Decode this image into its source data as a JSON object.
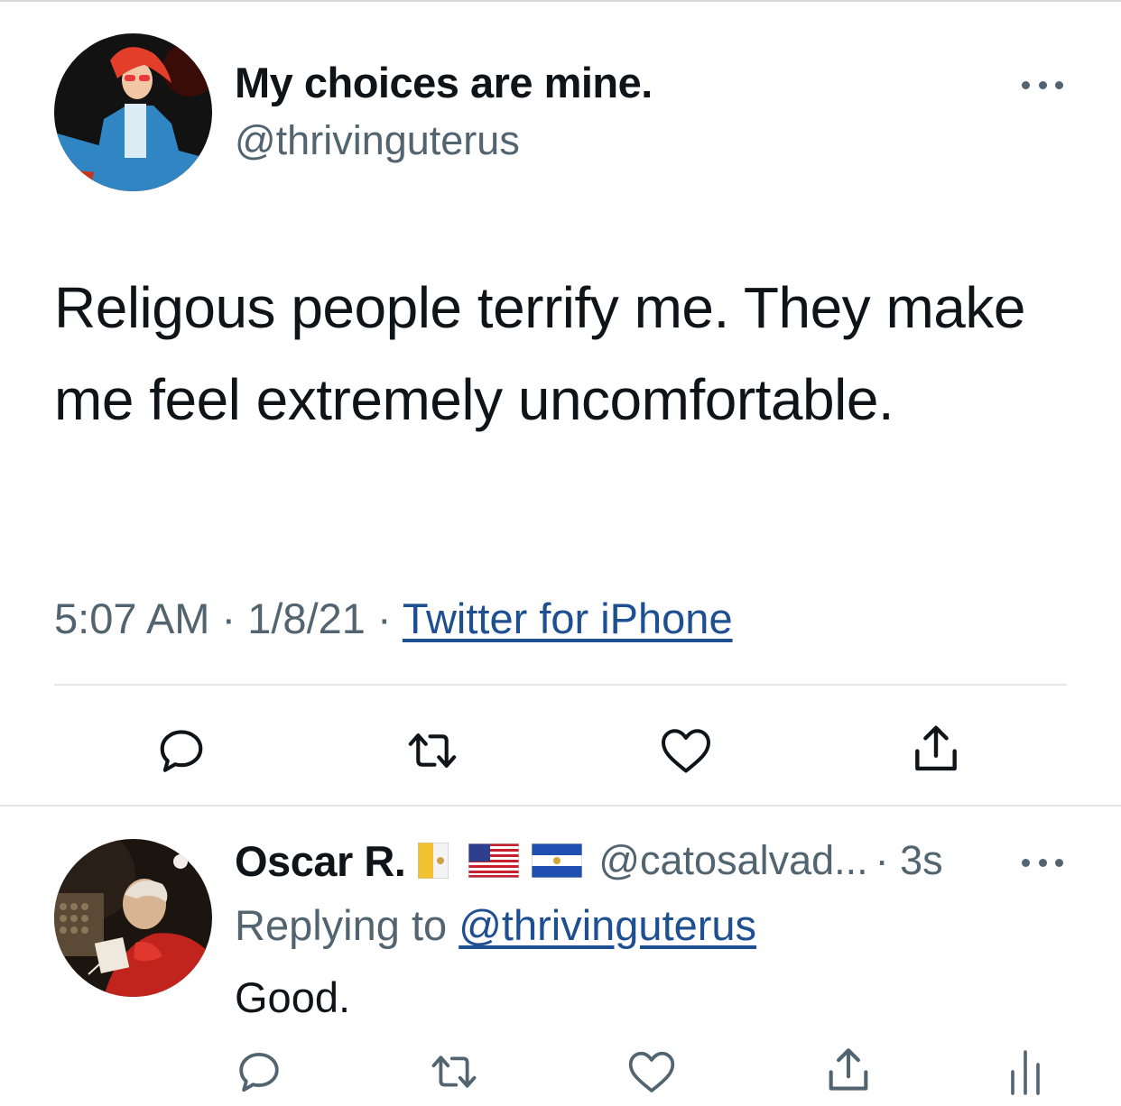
{
  "tweet": {
    "display_name": "My choices are mine.",
    "handle": "@thrivinguterus",
    "text": "Religous people terrify me. They make me feel extremely uncomfortable.",
    "time": "5:07 AM",
    "date": "1/8/21",
    "separator": "·",
    "source": "Twitter for iPhone",
    "avatar_icon": "illustrated-woman-avatar",
    "more_icon": "more-horizontal-icon",
    "actions": [
      "reply-icon",
      "retweet-icon",
      "like-icon",
      "share-icon"
    ]
  },
  "reply": {
    "display_name": "Oscar R.",
    "flags": [
      "vatican-flag",
      "us-flag",
      "el-salvador-flag"
    ],
    "handle": "@catosalvad...",
    "time": "· 3s",
    "replying_prefix": "Replying to",
    "replying_mention": "@thrivinguterus",
    "text": "Good.",
    "avatar_icon": "painting-portrait-avatar",
    "actions": [
      "reply-icon",
      "retweet-icon",
      "like-icon",
      "share-icon",
      "analytics-icon"
    ]
  },
  "colors": {
    "text": "#0f1419",
    "secondary": "#536471",
    "link": "#1d4f91",
    "divider": "#e6e6e6"
  }
}
